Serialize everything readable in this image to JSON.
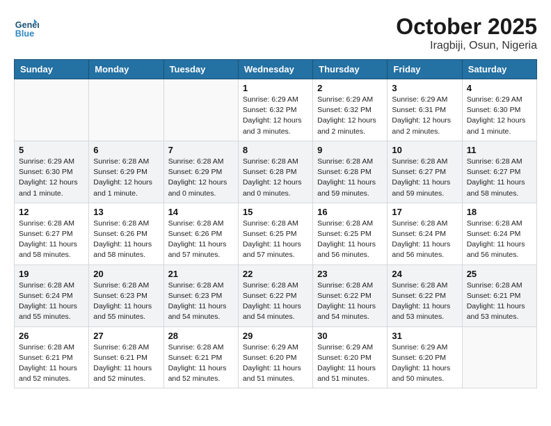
{
  "logo": {
    "line1": "General",
    "line2": "Blue"
  },
  "title": "October 2025",
  "location": "Iragbiji, Osun, Nigeria",
  "days_of_week": [
    "Sunday",
    "Monday",
    "Tuesday",
    "Wednesday",
    "Thursday",
    "Friday",
    "Saturday"
  ],
  "weeks": [
    [
      {
        "day": "",
        "info": ""
      },
      {
        "day": "",
        "info": ""
      },
      {
        "day": "",
        "info": ""
      },
      {
        "day": "1",
        "info": "Sunrise: 6:29 AM\nSunset: 6:32 PM\nDaylight: 12 hours\nand 3 minutes."
      },
      {
        "day": "2",
        "info": "Sunrise: 6:29 AM\nSunset: 6:32 PM\nDaylight: 12 hours\nand 2 minutes."
      },
      {
        "day": "3",
        "info": "Sunrise: 6:29 AM\nSunset: 6:31 PM\nDaylight: 12 hours\nand 2 minutes."
      },
      {
        "day": "4",
        "info": "Sunrise: 6:29 AM\nSunset: 6:30 PM\nDaylight: 12 hours\nand 1 minute."
      }
    ],
    [
      {
        "day": "5",
        "info": "Sunrise: 6:29 AM\nSunset: 6:30 PM\nDaylight: 12 hours\nand 1 minute."
      },
      {
        "day": "6",
        "info": "Sunrise: 6:28 AM\nSunset: 6:29 PM\nDaylight: 12 hours\nand 1 minute."
      },
      {
        "day": "7",
        "info": "Sunrise: 6:28 AM\nSunset: 6:29 PM\nDaylight: 12 hours\nand 0 minutes."
      },
      {
        "day": "8",
        "info": "Sunrise: 6:28 AM\nSunset: 6:28 PM\nDaylight: 12 hours\nand 0 minutes."
      },
      {
        "day": "9",
        "info": "Sunrise: 6:28 AM\nSunset: 6:28 PM\nDaylight: 11 hours\nand 59 minutes."
      },
      {
        "day": "10",
        "info": "Sunrise: 6:28 AM\nSunset: 6:27 PM\nDaylight: 11 hours\nand 59 minutes."
      },
      {
        "day": "11",
        "info": "Sunrise: 6:28 AM\nSunset: 6:27 PM\nDaylight: 11 hours\nand 58 minutes."
      }
    ],
    [
      {
        "day": "12",
        "info": "Sunrise: 6:28 AM\nSunset: 6:27 PM\nDaylight: 11 hours\nand 58 minutes."
      },
      {
        "day": "13",
        "info": "Sunrise: 6:28 AM\nSunset: 6:26 PM\nDaylight: 11 hours\nand 58 minutes."
      },
      {
        "day": "14",
        "info": "Sunrise: 6:28 AM\nSunset: 6:26 PM\nDaylight: 11 hours\nand 57 minutes."
      },
      {
        "day": "15",
        "info": "Sunrise: 6:28 AM\nSunset: 6:25 PM\nDaylight: 11 hours\nand 57 minutes."
      },
      {
        "day": "16",
        "info": "Sunrise: 6:28 AM\nSunset: 6:25 PM\nDaylight: 11 hours\nand 56 minutes."
      },
      {
        "day": "17",
        "info": "Sunrise: 6:28 AM\nSunset: 6:24 PM\nDaylight: 11 hours\nand 56 minutes."
      },
      {
        "day": "18",
        "info": "Sunrise: 6:28 AM\nSunset: 6:24 PM\nDaylight: 11 hours\nand 56 minutes."
      }
    ],
    [
      {
        "day": "19",
        "info": "Sunrise: 6:28 AM\nSunset: 6:24 PM\nDaylight: 11 hours\nand 55 minutes."
      },
      {
        "day": "20",
        "info": "Sunrise: 6:28 AM\nSunset: 6:23 PM\nDaylight: 11 hours\nand 55 minutes."
      },
      {
        "day": "21",
        "info": "Sunrise: 6:28 AM\nSunset: 6:23 PM\nDaylight: 11 hours\nand 54 minutes."
      },
      {
        "day": "22",
        "info": "Sunrise: 6:28 AM\nSunset: 6:22 PM\nDaylight: 11 hours\nand 54 minutes."
      },
      {
        "day": "23",
        "info": "Sunrise: 6:28 AM\nSunset: 6:22 PM\nDaylight: 11 hours\nand 54 minutes."
      },
      {
        "day": "24",
        "info": "Sunrise: 6:28 AM\nSunset: 6:22 PM\nDaylight: 11 hours\nand 53 minutes."
      },
      {
        "day": "25",
        "info": "Sunrise: 6:28 AM\nSunset: 6:21 PM\nDaylight: 11 hours\nand 53 minutes."
      }
    ],
    [
      {
        "day": "26",
        "info": "Sunrise: 6:28 AM\nSunset: 6:21 PM\nDaylight: 11 hours\nand 52 minutes."
      },
      {
        "day": "27",
        "info": "Sunrise: 6:28 AM\nSunset: 6:21 PM\nDaylight: 11 hours\nand 52 minutes."
      },
      {
        "day": "28",
        "info": "Sunrise: 6:28 AM\nSunset: 6:21 PM\nDaylight: 11 hours\nand 52 minutes."
      },
      {
        "day": "29",
        "info": "Sunrise: 6:29 AM\nSunset: 6:20 PM\nDaylight: 11 hours\nand 51 minutes."
      },
      {
        "day": "30",
        "info": "Sunrise: 6:29 AM\nSunset: 6:20 PM\nDaylight: 11 hours\nand 51 minutes."
      },
      {
        "day": "31",
        "info": "Sunrise: 6:29 AM\nSunset: 6:20 PM\nDaylight: 11 hours\nand 50 minutes."
      },
      {
        "day": "",
        "info": ""
      }
    ]
  ]
}
